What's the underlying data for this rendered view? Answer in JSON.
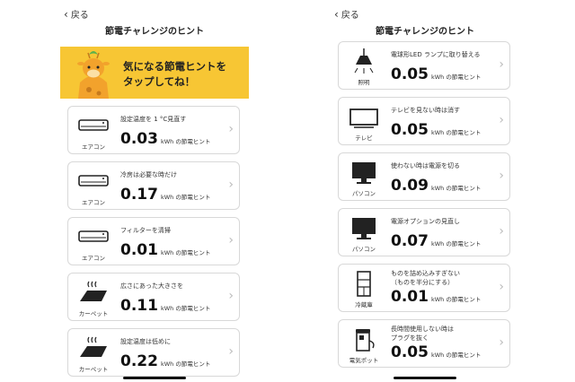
{
  "left": {
    "back_label": "戻る",
    "title": "節電チャレンジのヒント",
    "banner_line1": "気になる節電ヒントを",
    "banner_line2": "タップしてね！",
    "cards": [
      {
        "tip": "設定温度を 1 °C見直す",
        "value": "0.03",
        "label": "エアコン",
        "icon": "air-conditioner-icon"
      },
      {
        "tip": "冷房は必要な時だけ",
        "value": "0.17",
        "label": "エアコン",
        "icon": "air-conditioner-icon"
      },
      {
        "tip": "フィルターを清掃",
        "value": "0.01",
        "label": "エアコン",
        "icon": "air-conditioner-icon"
      },
      {
        "tip": "広さにあった大きさを",
        "value": "0.11",
        "label": "カーペット",
        "icon": "heated-carpet-icon"
      },
      {
        "tip": "設定温度は低めに",
        "value": "0.22",
        "label": "カーペット",
        "icon": "heated-carpet-icon"
      }
    ]
  },
  "right": {
    "back_label": "戻る",
    "title": "節電チャレンジのヒント",
    "cards": [
      {
        "tip": "電球形LED ランプに取り替える",
        "value": "0.05",
        "label": "照明",
        "icon": "ceiling-lamp-icon"
      },
      {
        "tip": "テレビを見ない時は消す",
        "value": "0.05",
        "label": "テレビ",
        "icon": "tv-icon"
      },
      {
        "tip": "使わない時は電源を切る",
        "value": "0.09",
        "label": "パソコン",
        "icon": "monitor-icon"
      },
      {
        "tip": "電源オプションの見直し",
        "value": "0.07",
        "label": "パソコン",
        "icon": "monitor-icon"
      },
      {
        "tip": "ものを詰め込みすぎない",
        "tip2": "（ものを半分にする）",
        "value": "0.01",
        "label": "冷蔵庫",
        "icon": "refrigerator-icon"
      },
      {
        "tip": "長時間使用しない時は",
        "tip2": "プラグを抜く",
        "value": "0.05",
        "label": "電気ポット",
        "icon": "electric-kettle-icon"
      }
    ]
  },
  "unit_label": "kWh の節電ヒント",
  "colors": {
    "banner": "#f7c634",
    "card_border": "#d8d8d8"
  }
}
